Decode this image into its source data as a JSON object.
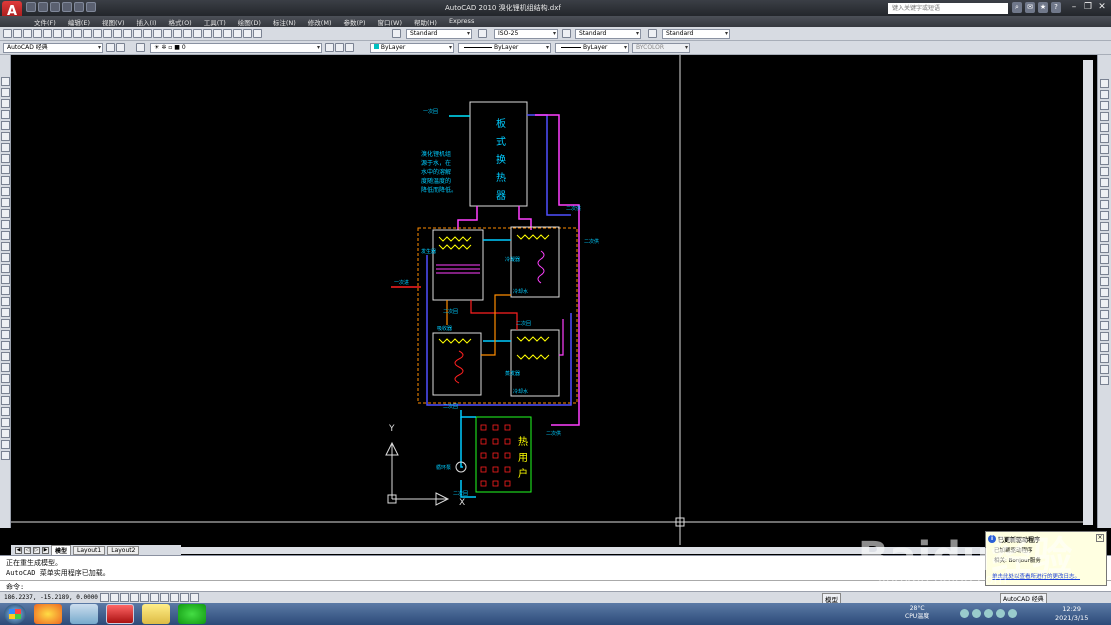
{
  "window": {
    "title": "AutoCAD 2010    溴化锂机组结构.dxf",
    "search_placeholder": "键入关键字或短语"
  },
  "menu": [
    "文件(F)",
    "编辑(E)",
    "视图(V)",
    "插入(I)",
    "格式(O)",
    "工具(T)",
    "绘图(D)",
    "标注(N)",
    "修改(M)",
    "参数(P)",
    "窗口(W)",
    "帮助(H)",
    "Express"
  ],
  "toolbar1": {
    "text_style": "Standard",
    "dim_style": "ISO-25",
    "table_style": "Standard",
    "mleader_style": "Standard"
  },
  "toolbar2": {
    "workspace": "AutoCAD 经典",
    "layer": "0",
    "color": "ByLayer",
    "linetype": "ByLayer",
    "lineweight": "ByLayer",
    "plotstyle": "BYCOLOR"
  },
  "drawing": {
    "exchanger_label": [
      "板",
      "式",
      "换",
      "热",
      "器"
    ],
    "note_lines": [
      "溴化锂机组",
      "源于水，在",
      "水中的溶解",
      "度随温度的",
      "降低而降低。"
    ],
    "user_label": [
      "热",
      "用",
      "户"
    ],
    "ucs_y": "Y",
    "ucs_x": "X",
    "small_labels": {
      "yici_in_top": "一次回",
      "yici_in_left": "一次进",
      "erci_a": "二次供",
      "erci_b": "二次供",
      "erci_c": "二次回",
      "erci_d": "二次回",
      "erci_e": "二次供",
      "erci_f": "二次回",
      "erci_g": "二次回",
      "pump": "循环泵",
      "cooling_water_1": "冷却水",
      "cooling_water_2": "冷却水",
      "evaporator": "蒸发器",
      "absorber": "吸收器",
      "generator": "发生器",
      "condenser": "冷凝器"
    }
  },
  "tabs": {
    "model": "模型",
    "layout1": "Layout1",
    "layout2": "Layout2"
  },
  "command": {
    "line1": "正在重生成模型。",
    "line2": "AutoCAD 菜单实用程序已加载。",
    "prompt": "命令:"
  },
  "status": {
    "coords": "186.2237,  -15.2189, 0.0000",
    "model_button": "模型",
    "workspace": "AutoCAD 经典"
  },
  "tray": {
    "temp": "28°C",
    "temp_label": "CPU温度",
    "time": "12:29",
    "date": "2021/3/15"
  },
  "balloon": {
    "title": "已更新驱动程序",
    "line1": "已加载驱动程序",
    "line2": "相关: Bonjour服务",
    "link": "单击此处以查看所进行的更改日志。"
  },
  "watermark": {
    "brand": "Baidu经验",
    "url": "jingyan.baidu.com"
  }
}
